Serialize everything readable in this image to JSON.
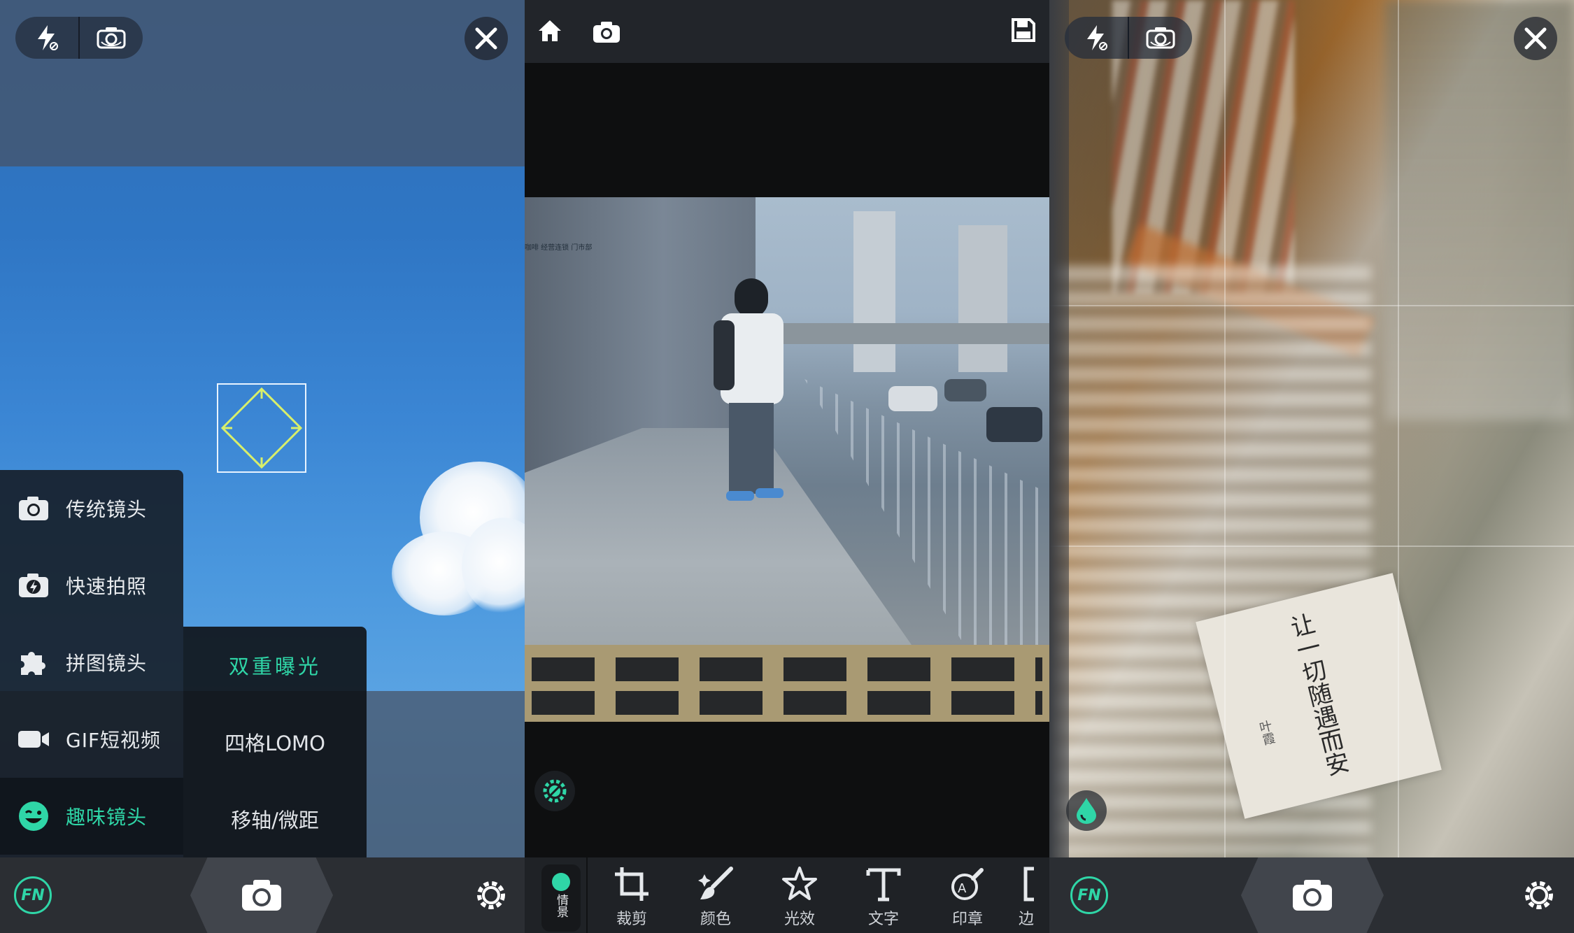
{
  "camera": {
    "menu": {
      "items": [
        {
          "label": "传统镜头",
          "icon": "camera-icon"
        },
        {
          "label": "快速拍照",
          "icon": "quick-shot-icon"
        },
        {
          "label": "拼图镜头",
          "icon": "puzzle-icon"
        },
        {
          "label": "GIF短视频",
          "icon": "video-icon"
        },
        {
          "label": "趣味镜头",
          "icon": "wink-face-icon",
          "active": true
        }
      ],
      "submenu": [
        "双重曝光",
        "四格LOMO",
        "移轴/微距"
      ],
      "active_submenu": "双重曝光"
    },
    "fn_badge": "FN"
  },
  "editor": {
    "photo_sign": "咖啡 经营连锁 门市部",
    "scene_tab": "情景",
    "tools": [
      {
        "label": "裁剪",
        "icon": "crop-icon"
      },
      {
        "label": "颜色",
        "icon": "brush-icon"
      },
      {
        "label": "光效",
        "icon": "star-icon"
      },
      {
        "label": "文字",
        "icon": "text-icon"
      },
      {
        "label": "印章",
        "icon": "stamp-icon"
      },
      {
        "label": "边",
        "icon": "border-icon"
      }
    ]
  },
  "tiltshift": {
    "book_title": "让一切随遇而安",
    "book_author": "叶霞",
    "fn_badge": "FN"
  },
  "colors": {
    "accent": "#2fd6a7",
    "bar": "#2b2e33"
  }
}
